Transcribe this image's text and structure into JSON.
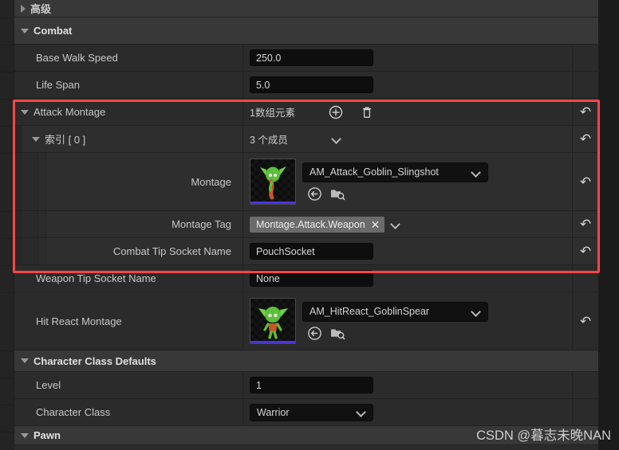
{
  "panel": {
    "accent_highlight_color": "#ff4545",
    "row_bg": "#2b2b2b",
    "category_bg": "#383838",
    "field_bg": "#0e0e0e"
  },
  "rows": [
    {
      "id": "advanced",
      "label": "高级",
      "kind": "category",
      "expanded": false,
      "value": ""
    },
    {
      "id": "combat",
      "label": "Combat",
      "kind": "category",
      "expanded": true,
      "value": ""
    },
    {
      "id": "base-walk-speed",
      "label": "Base Walk Speed",
      "kind": "number",
      "value": "250.0"
    },
    {
      "id": "life-span",
      "label": "Life Span",
      "kind": "number",
      "value": "5.0"
    },
    {
      "id": "attack-montage",
      "label": "Attack Montage",
      "kind": "array",
      "expanded": true,
      "value": "1数组元素"
    },
    {
      "id": "index-0",
      "label": "索引 [ 0 ]",
      "kind": "struct",
      "expanded": true,
      "value": "3 个成员"
    },
    {
      "id": "montage",
      "label": "Montage",
      "kind": "asset",
      "value": "AM_Attack_Goblin_Slingshot"
    },
    {
      "id": "montage-tag",
      "label": "Montage Tag",
      "kind": "tag",
      "value": "Montage.Attack.Weapon"
    },
    {
      "id": "combat-tip-socket-name",
      "label": "Combat Tip Socket Name",
      "kind": "text",
      "value": "PouchSocket"
    },
    {
      "id": "weapon-tip-socket-name",
      "label": "Weapon Tip Socket Name",
      "kind": "text",
      "value": "None"
    },
    {
      "id": "hit-react-montage",
      "label": "Hit React Montage",
      "kind": "asset",
      "value": "AM_HitReact_GoblinSpear"
    },
    {
      "id": "character-class-defaults",
      "label": "Character Class Defaults",
      "kind": "category",
      "expanded": true,
      "value": ""
    },
    {
      "id": "level",
      "label": "Level",
      "kind": "number",
      "value": "1"
    },
    {
      "id": "character-class",
      "label": "Character Class",
      "kind": "combo",
      "value": "Warrior"
    },
    {
      "id": "pawn",
      "label": "Pawn",
      "kind": "category",
      "expanded": true,
      "value": ""
    }
  ],
  "icons": {
    "add_element": "add-array-element-icon",
    "delete_all": "delete-array-icon",
    "reset": "reset-to-default-icon",
    "use_selected": "use-selected-asset-icon",
    "browse": "browse-to-asset-icon",
    "clear_tag": "clear-tag-icon",
    "dropdown": "chevron-down-icon"
  },
  "watermark": {
    "text": "CSDN @暮志未晚NAN"
  }
}
